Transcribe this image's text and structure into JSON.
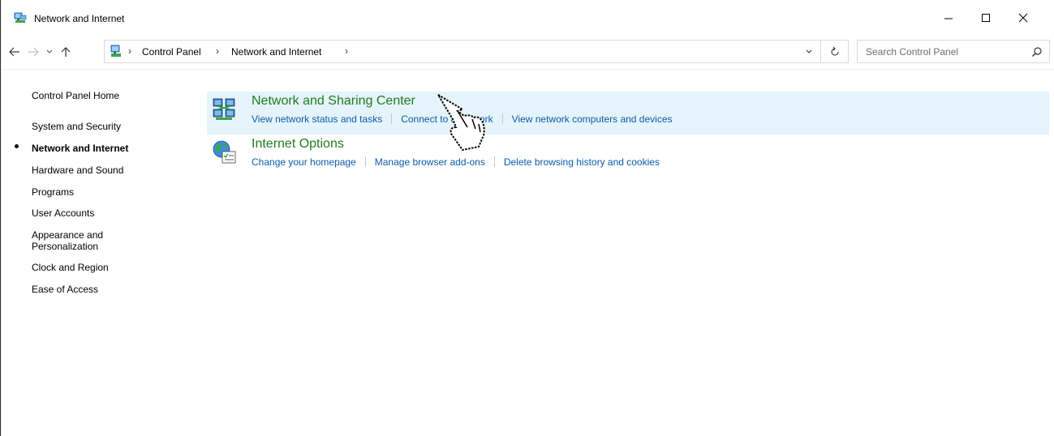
{
  "window": {
    "title": "Network and Internet",
    "minimize_glyph": "—",
    "maximize_glyph": "☐",
    "close_glyph": "✕"
  },
  "nav": {
    "back_icon": "back-arrow-icon",
    "forward_icon": "forward-arrow-icon",
    "recent_icon": "chevron-down-icon",
    "up_icon": "up-arrow-icon"
  },
  "address": {
    "crumbs": [
      "Control Panel",
      "Network and Internet"
    ],
    "separator": "›"
  },
  "search": {
    "placeholder": "Search Control Panel"
  },
  "sidebar": {
    "items": [
      {
        "label": "Control Panel Home"
      },
      {
        "label": "System and Security"
      },
      {
        "label": "Network and Internet",
        "active": true
      },
      {
        "label": "Hardware and Sound"
      },
      {
        "label": "Programs"
      },
      {
        "label": "User Accounts"
      },
      {
        "label": "Appearance and"
      },
      {
        "label": "Personalization"
      },
      {
        "label": "Clock and Region"
      },
      {
        "label": "Ease of Access"
      }
    ]
  },
  "categories": [
    {
      "title": "Network and Sharing Center",
      "icon": "network-sharing-icon",
      "links": [
        "View network status and tasks",
        "Connect to a network",
        "View network computers and devices"
      ]
    },
    {
      "title": "Internet Options",
      "icon": "internet-options-icon",
      "links": [
        "Change your homepage",
        "Manage browser add-ons",
        "Delete browsing history and cookies"
      ]
    }
  ],
  "colors": {
    "category_title": "#1e7b1e",
    "link": "#0b5cad",
    "hover_background": "#e5f3fb"
  }
}
